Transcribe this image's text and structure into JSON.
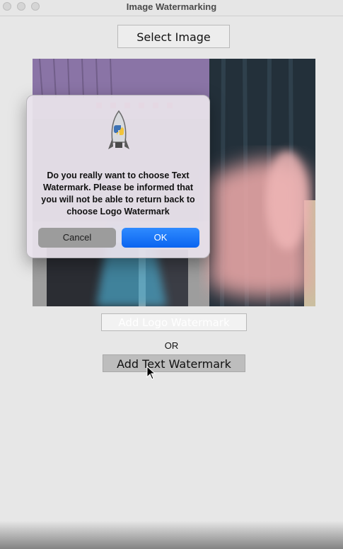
{
  "window": {
    "title": "Image Watermarking"
  },
  "main": {
    "select_image_label": "Select Image",
    "add_logo_label": "Add Logo Watermark",
    "or_label": "OR",
    "add_text_label": "Add Text Watermark"
  },
  "dialog": {
    "icon": "python-rocket-icon",
    "message": "Do you really want to choose Text Watermark. Please be informed that you will not be able to return back to choose Logo Watermark",
    "cancel_label": "Cancel",
    "ok_label": "OK"
  },
  "colors": {
    "ok_button": "#0a64f0",
    "cancel_button": "#9c9c9c",
    "background": "#e7e7e7"
  }
}
